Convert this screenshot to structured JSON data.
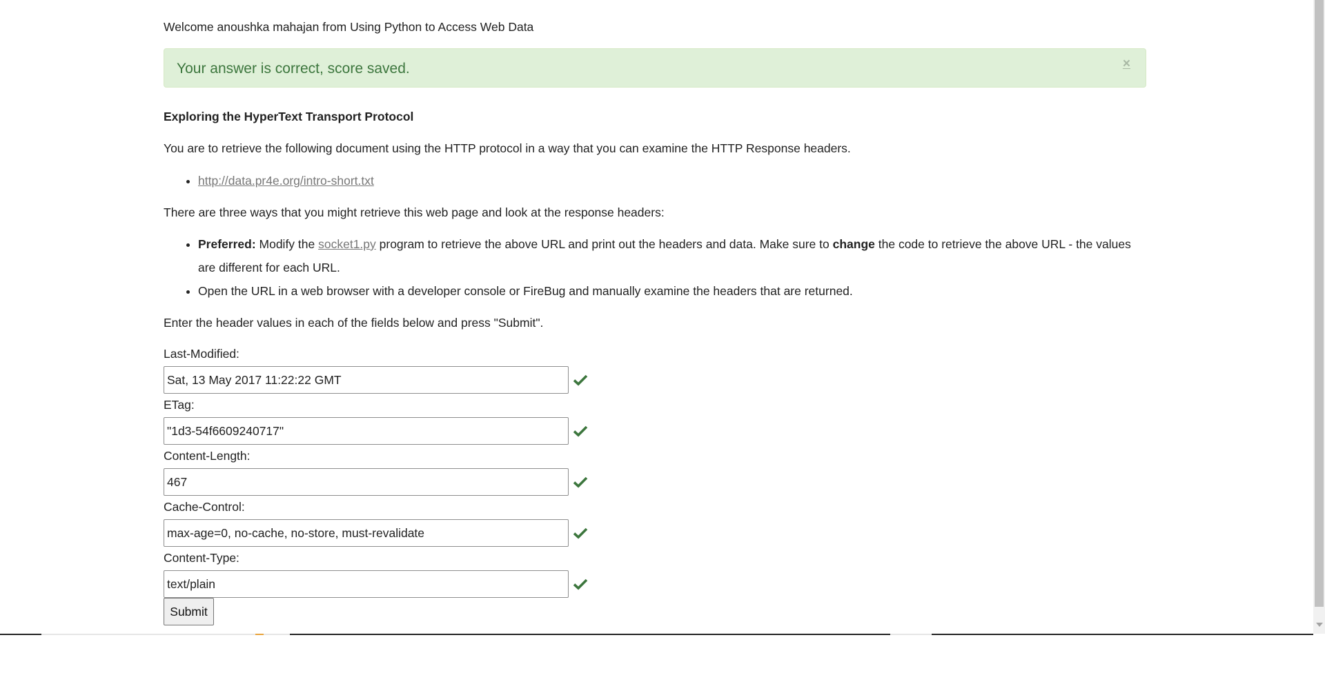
{
  "welcome": "Welcome anoushka mahajan from Using Python to Access Web Data",
  "alert": {
    "message": "Your answer is correct, score saved.",
    "close_glyph": "×"
  },
  "heading": "Exploring the HyperText Transport Protocol",
  "intro": "You are to retrieve the following document using the HTTP protocol in a way that you can examine the HTTP Response headers.",
  "url_link": "http://data.pr4e.org/intro-short.txt",
  "ways_text": "There are three ways that you might retrieve this web page and look at the response headers:",
  "preferred": {
    "bold": "Preferred:",
    "text_a": " Modify the ",
    "link": "socket1.py",
    "text_b": " program to retrieve the above URL and print out the headers and data. Make sure to ",
    "bold2": "change",
    "text_c": " the code to retrieve the above URL - the values are different for each URL."
  },
  "browser_way": "Open the URL in a web browser with a developer console or FireBug and manually examine the headers that are returned.",
  "instructions": "Enter the header values in each of the fields below and press \"Submit\".",
  "fields": [
    {
      "label": "Last-Modified:",
      "value": "Sat, 13 May 2017 11:22:22 GMT"
    },
    {
      "label": "ETag:",
      "value": "\"1d3-54f6609240717\""
    },
    {
      "label": "Content-Length:",
      "value": "467"
    },
    {
      "label": "Cache-Control:",
      "value": "max-age=0, no-cache, no-store, must-revalidate"
    },
    {
      "label": "Content-Type:",
      "value": "text/plain"
    }
  ],
  "submit_label": "Submit",
  "colors": {
    "success_bg": "#dff0d8",
    "success_text": "#3c763d",
    "check": "#3c763d"
  },
  "icons": {
    "check": "check-icon",
    "close": "close-icon"
  }
}
